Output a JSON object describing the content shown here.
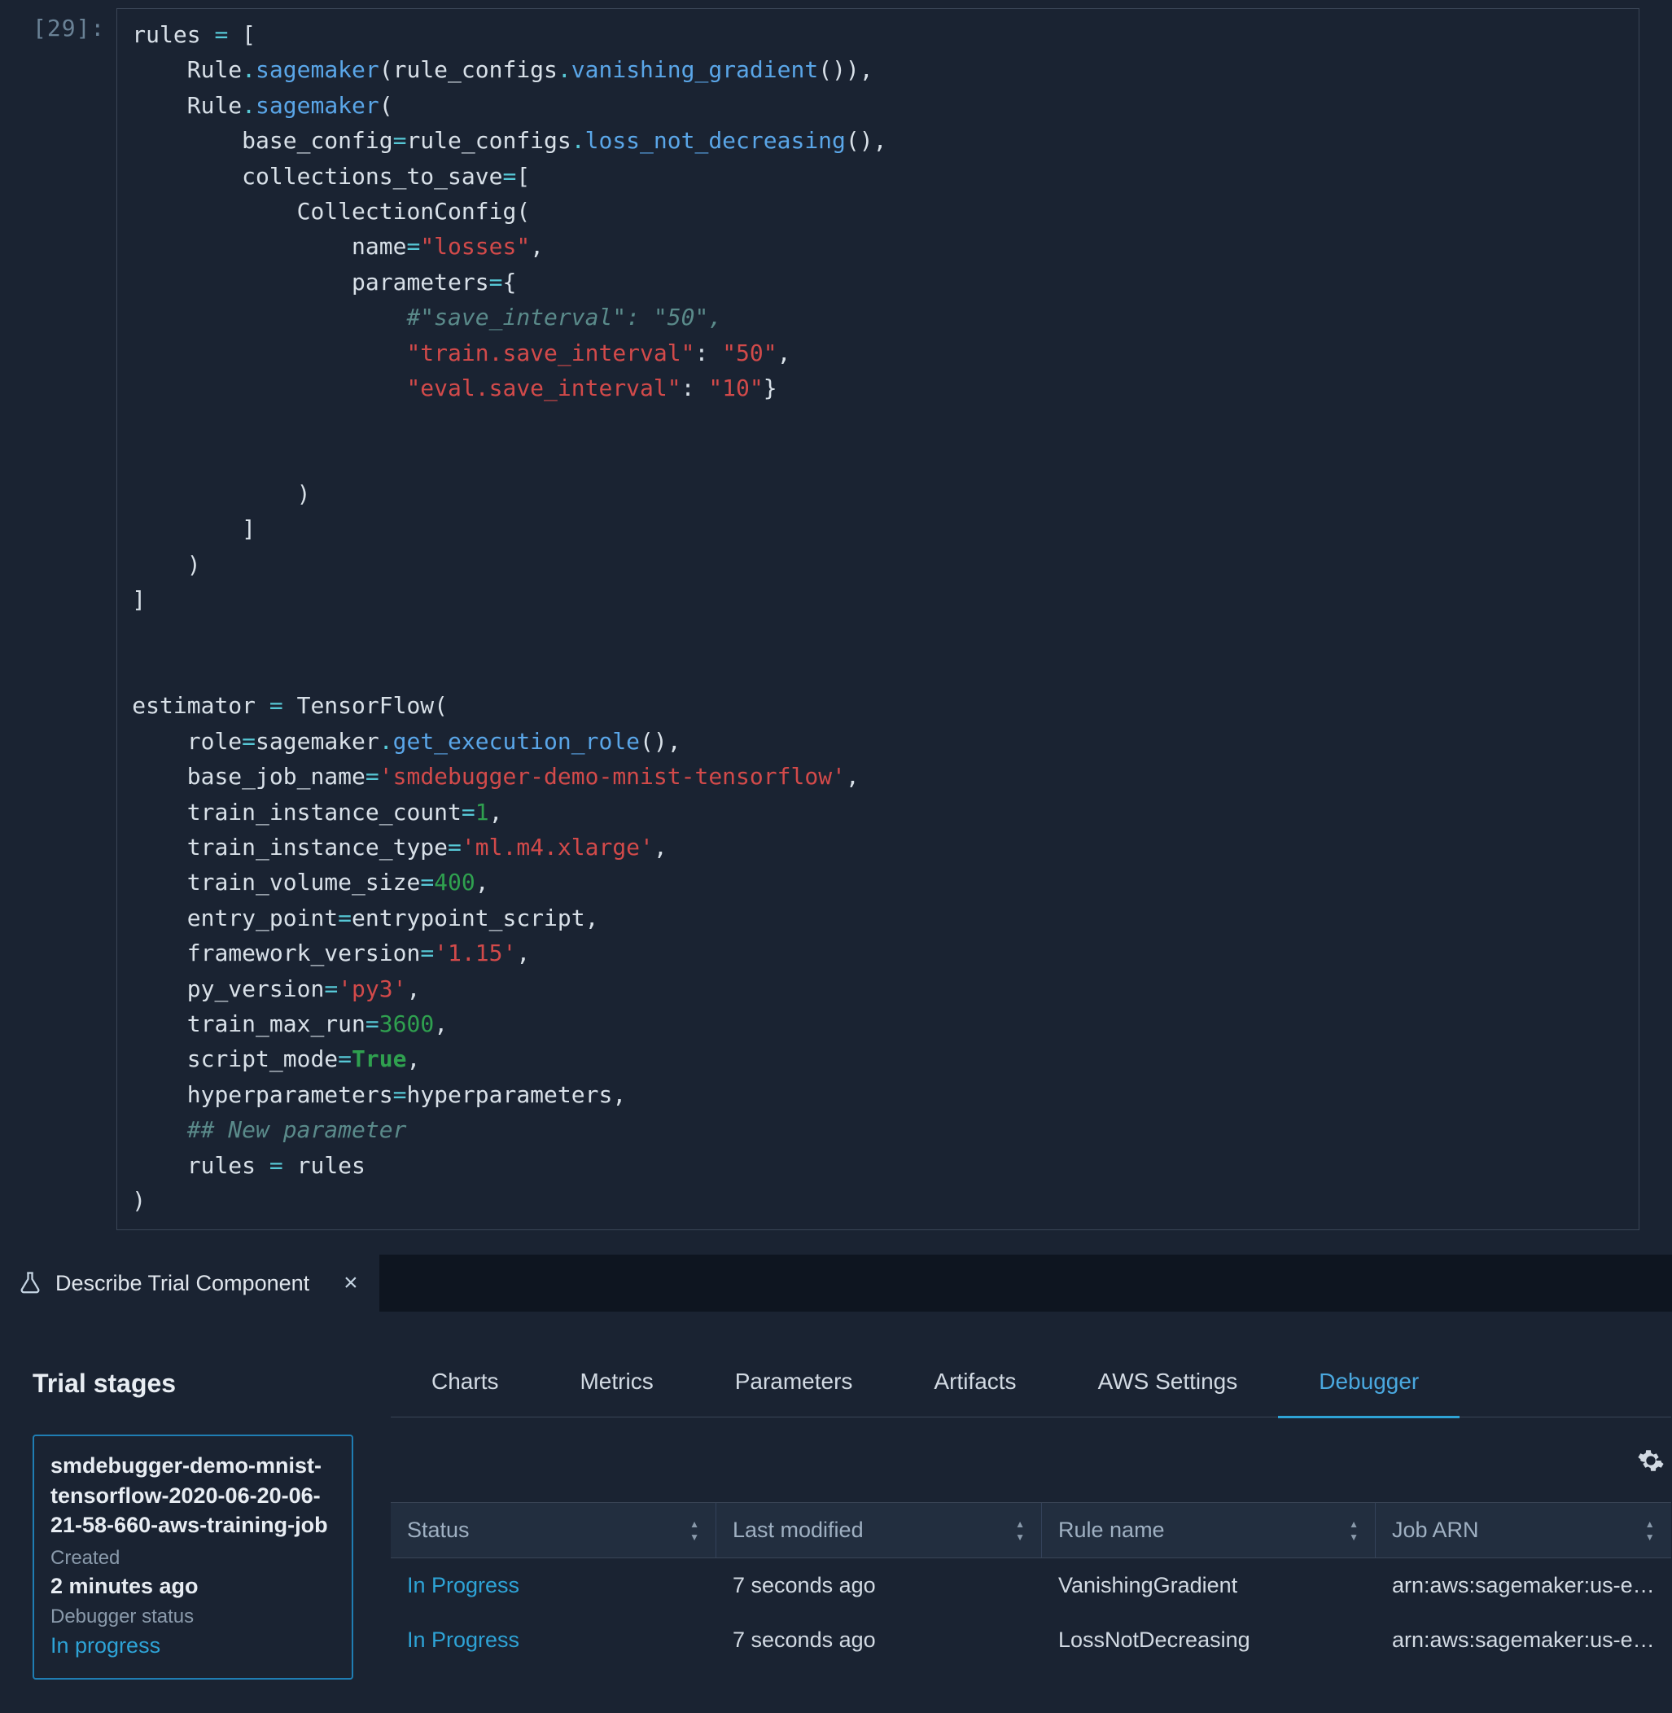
{
  "cell": {
    "prompt": "[29]:"
  },
  "panel": {
    "tab_title": "Describe Trial Component"
  },
  "trial_stages": {
    "heading": "Trial stages",
    "card": {
      "jobname": "smdebugger-demo-mnist-tensorflow-2020-06-20-06-21-58-660-aws-training-job",
      "created_label": "Created",
      "created_value": "2 minutes ago",
      "debugger_label": "Debugger status",
      "debugger_value": "In progress"
    }
  },
  "tabs": {
    "charts": "Charts",
    "metrics": "Metrics",
    "parameters": "Parameters",
    "artifacts": "Artifacts",
    "aws_settings": "AWS Settings",
    "debugger": "Debugger"
  },
  "table": {
    "headers": {
      "status": "Status",
      "last_modified": "Last modified",
      "rule_name": "Rule name",
      "job_arn": "Job ARN"
    },
    "rows": [
      {
        "status": "In Progress",
        "last_modified": "7 seconds ago",
        "rule_name": "VanishingGradient",
        "job_arn": "arn:aws:sagemaker:us-e…"
      },
      {
        "status": "In Progress",
        "last_modified": "7 seconds ago",
        "rule_name": "LossNotDecreasing",
        "job_arn": "arn:aws:sagemaker:us-e…"
      }
    ]
  },
  "code": {
    "t": {
      "rules": "rules",
      "eq": "=",
      "lbr": "[",
      "rbr": "]",
      "Rule": "Rule",
      "dot": ".",
      "sagemaker": "sagemaker",
      "lp": "(",
      "rp": ")",
      "rule_configs": "rule_configs",
      "vanishing_gradient": "vanishing_gradient",
      "comma": ",",
      "base_config": "base_config",
      "loss_not_decreasing": "loss_not_decreasing",
      "collections_to_save": "collections_to_save",
      "CollectionConfig": "CollectionConfig",
      "name": "name",
      "losses_str": "\"losses\"",
      "parameters": "parameters",
      "lcb": "{",
      "rcb": "}",
      "save_interval_cm": "#\"save_interval\": \"50\",",
      "train_save": "\"train.save_interval\"",
      "colon": ":",
      "fifty": "\"50\"",
      "eval_save": "\"eval.save_interval\"",
      "ten": "\"10\"",
      "estimator": "estimator",
      "TensorFlow": "TensorFlow",
      "role": "role",
      "sagemaker_l": "sagemaker",
      "get_execution_role": "get_execution_role",
      "base_job_name": "base_job_name",
      "bjn_str": "'smdebugger-demo-mnist-tensorflow'",
      "train_instance_count": "train_instance_count",
      "one": "1",
      "train_instance_type": "train_instance_type",
      "tit_str": "'ml.m4.xlarge'",
      "train_volume_size": "train_volume_size",
      "fourhundred": "400",
      "entry_point": "entry_point",
      "entrypoint_script": "entrypoint_script",
      "framework_version": "framework_version",
      "fv_str": "'1.15'",
      "py_version": "py_version",
      "py3": "'py3'",
      "train_max_run": "train_max_run",
      "tmr": "3600",
      "script_mode": "script_mode",
      "True": "True",
      "hyperparameters": "hyperparameters",
      "new_param_cm": "## New parameter",
      "rules2": "rules",
      "sp": " "
    }
  }
}
